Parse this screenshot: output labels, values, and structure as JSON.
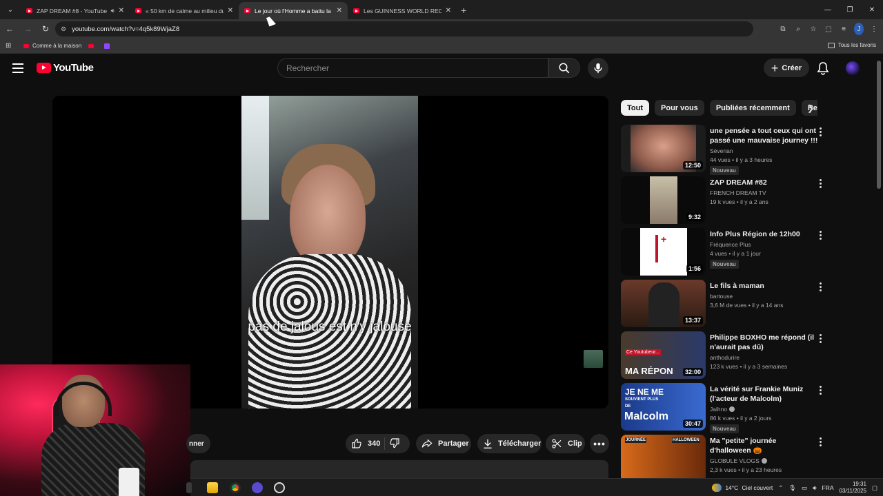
{
  "browser": {
    "tabs": [
      {
        "title": "ZAP DREAM #8 - YouTube",
        "active": false,
        "audio": true
      },
      {
        "title": "« 50 km de calme au milieu du",
        "active": false
      },
      {
        "title": "Le jour où l'Homme a battu la",
        "active": true
      },
      {
        "title": "Les GUINNESS WORLD RECORD",
        "active": false
      }
    ],
    "url": "youtube.com/watch?v=4q5k89WjaZ8",
    "profile_initial": "J",
    "bookmarks": [
      {
        "label": "Comme à la maison",
        "icon": "youtube-icon"
      },
      {
        "label": "",
        "icon": "youtube-icon"
      },
      {
        "label": "",
        "icon": "twitch-icon"
      }
    ],
    "all_favorites": "Tous les favoris"
  },
  "youtube": {
    "logo_text": "YouTube",
    "search_placeholder": "Rechercher",
    "create_label": "Créer",
    "video_caption": "pas de jalous est n'y jalouse",
    "actions": {
      "subscribe_fragment": "nner",
      "like_count": "340",
      "share": "Partager",
      "download": "Télécharger",
      "clip": "Clip"
    },
    "chips": [
      "Tout",
      "Pour vous",
      "Publiées récemment",
      "Re"
    ],
    "recommendations": [
      {
        "title": "une pensée a tout ceux qui ont passé une mauvaise journey !!!",
        "channel": "Séverian",
        "verified": false,
        "meta": "44 vues • il y a 3 heures",
        "badge": "Nouveau",
        "duration": "12:50"
      },
      {
        "title": "ZAP DREAM #82",
        "channel": "FRENCH DREAM TV",
        "verified": false,
        "meta": "19 k vues • il y a 2 ans",
        "badge": "",
        "duration": "9:32"
      },
      {
        "title": "Info Plus Région de 12h00",
        "channel": "Fréquence Plus",
        "verified": false,
        "meta": "4 vues • il y a 1 jour",
        "badge": "Nouveau",
        "duration": "1:56"
      },
      {
        "title": "Le fils à maman",
        "channel": "bartouse",
        "verified": false,
        "meta": "3,6 M de vues • il y a 14 ans",
        "badge": "",
        "duration": "13:37"
      },
      {
        "title": "Philippe BOXHO me répond (il n'aurait pas dû)",
        "channel": "anthodurire",
        "verified": false,
        "meta": "123 k vues • il y a 3 semaines",
        "badge": "",
        "duration": "32:00"
      },
      {
        "title": "La vérité sur Frankie Muniz (l'acteur de Malcolm)",
        "channel": "Jaihno",
        "verified": true,
        "meta": "86 k vues • il y a 2 jours",
        "badge": "Nouveau",
        "duration": "30:47"
      },
      {
        "title": "Ma \"petite\" journée d'halloween 🎃",
        "channel": "GLOBULE VLOGS",
        "verified": true,
        "meta": "2,3 k vues • il y a 23 heures",
        "badge": "",
        "duration": ""
      }
    ],
    "thumb_texts": {
      "rec5": "MA RÉPON",
      "rec5_small": "Ce Youtubeur...",
      "rec6_line1": "JE NE ME",
      "rec6_line2": "SOUVIENT PLUS",
      "rec6_line3": "DE",
      "rec6_line4": "Malcolm",
      "rec7_a": "JOURNÉE",
      "rec7_b": "HALLOWEEN"
    }
  },
  "taskbar": {
    "temperature": "14°C",
    "weather": "Ciel couvert",
    "language": "FRA",
    "time": "19:31",
    "date": "03/11/2025"
  },
  "colors": {
    "youtube_red": "#ff0033",
    "background": "#0f0f0f",
    "chip_bg": "#272727"
  }
}
